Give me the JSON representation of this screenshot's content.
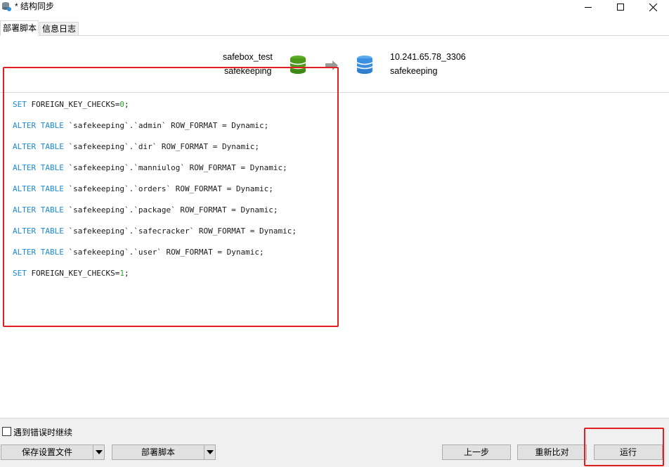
{
  "window": {
    "title": "* 结构同步",
    "app_icon": "db-sync-icon",
    "controls": {
      "minimize": "minimize-icon",
      "maximize": "maximize-icon",
      "close": "close-icon"
    }
  },
  "tabs": [
    {
      "label": "部署脚本",
      "active": true
    },
    {
      "label": "信息日志",
      "active": false
    }
  ],
  "source": {
    "connection": "safebox_test",
    "database": "safekeeping",
    "icon": "database-icon",
    "color": "#4a9a1c"
  },
  "target": {
    "connection": "10.241.65.78_3306",
    "database": "safekeeping",
    "icon": "database-icon",
    "color": "#3b8fe0"
  },
  "transfer_icon": "arrow-right-icon",
  "script_lines": [
    {
      "keyword": "SET",
      "text": " FOREIGN_KEY_CHECKS=",
      "number": "0",
      "tail": ";"
    },
    {
      "keyword": "ALTER TABLE",
      "text": " `safekeeping`.`admin` ROW_FORMAT = Dynamic;",
      "number": "",
      "tail": ""
    },
    {
      "keyword": "ALTER TABLE",
      "text": " `safekeeping`.`dir` ROW_FORMAT = Dynamic;",
      "number": "",
      "tail": ""
    },
    {
      "keyword": "ALTER TABLE",
      "text": " `safekeeping`.`manniulog` ROW_FORMAT = Dynamic;",
      "number": "",
      "tail": ""
    },
    {
      "keyword": "ALTER TABLE",
      "text": " `safekeeping`.`orders` ROW_FORMAT = Dynamic;",
      "number": "",
      "tail": ""
    },
    {
      "keyword": "ALTER TABLE",
      "text": " `safekeeping`.`package` ROW_FORMAT = Dynamic;",
      "number": "",
      "tail": ""
    },
    {
      "keyword": "ALTER TABLE",
      "text": " `safekeeping`.`safecracker` ROW_FORMAT = Dynamic;",
      "number": "",
      "tail": ""
    },
    {
      "keyword": "ALTER TABLE",
      "text": " `safekeeping`.`user` ROW_FORMAT = Dynamic;",
      "number": "",
      "tail": ""
    },
    {
      "keyword": "SET",
      "text": " FOREIGN_KEY_CHECKS=",
      "number": "1",
      "tail": ";"
    }
  ],
  "options": {
    "continue_on_error_label": "遇到错误时继续",
    "continue_on_error_checked": false
  },
  "buttons": {
    "save_profile": "保存设置文件",
    "deploy_script": "部署脚本",
    "previous": "上一步",
    "recompare": "重新比对",
    "run": "运行"
  },
  "colors": {
    "keyword": "#1a8ad6",
    "number": "#27a527",
    "highlight": "#e02020"
  }
}
